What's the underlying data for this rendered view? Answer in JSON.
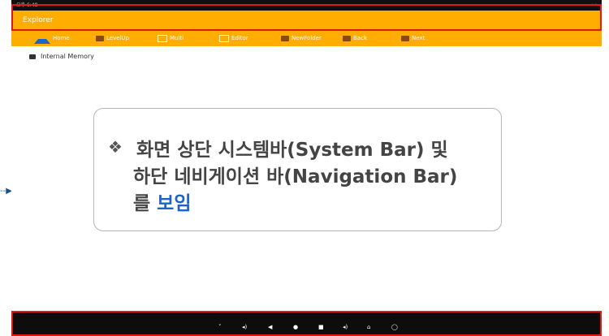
{
  "status": {
    "time": "오후 6:48",
    "right": "••"
  },
  "window": {
    "title": "Explorer"
  },
  "toolbar": {
    "items": [
      {
        "label": "Home",
        "icon": "home-icon"
      },
      {
        "label": "LevelUp",
        "icon": "folder-up-icon"
      },
      {
        "label": "Multi",
        "icon": "multi-icon"
      },
      {
        "label": "Editor",
        "icon": "edit-icon"
      },
      {
        "label": "NewFolder",
        "icon": "new-folder-icon"
      },
      {
        "label": "Back",
        "icon": "back-folder-icon"
      },
      {
        "label": "Next",
        "icon": "next-folder-icon"
      }
    ]
  },
  "content": {
    "items": [
      {
        "label": "Internal Memory",
        "icon": "memory-icon"
      }
    ]
  },
  "callout": {
    "bullet": "❖",
    "line1": "화면 상단 시스템바(System Bar) 및",
    "line2": "하단 네비게이션 바(Navigation Bar)",
    "line3_prefix": "를 ",
    "line3_highlight": "보임"
  },
  "navbar": {
    "buttons": [
      "˅",
      "◂)",
      "◀",
      "●",
      "■",
      "◂)",
      "⌂",
      "◯"
    ]
  },
  "colors": {
    "accent": "#ffad00",
    "highlight": "#1f63c6",
    "annotation": "#e01818"
  }
}
